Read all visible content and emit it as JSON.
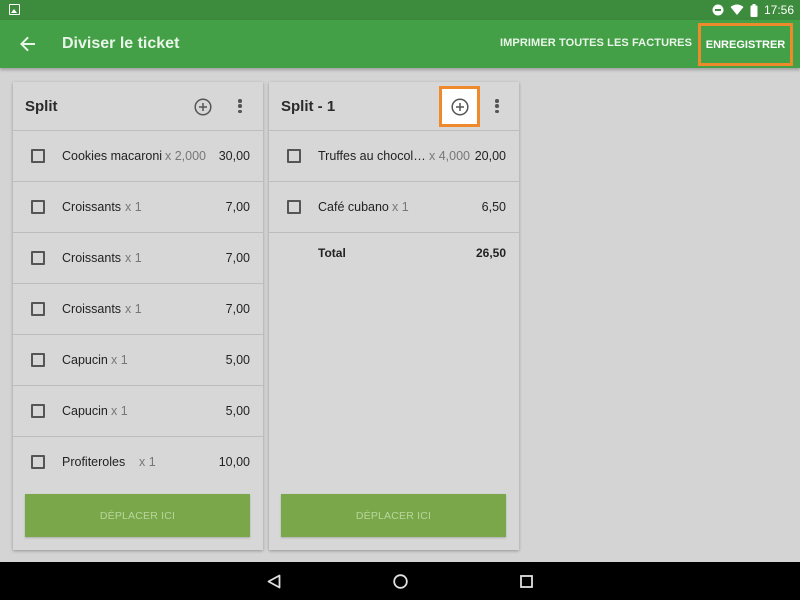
{
  "status_bar": {
    "time": "17:56",
    "icons": [
      "image-icon",
      "do-not-disturb-icon",
      "wifi-icon",
      "battery-icon"
    ]
  },
  "app_bar": {
    "title": "Diviser le ticket",
    "print_all_label": "IMPRIMER TOUTES LES FACTURES",
    "save_label": "ENREGISTRER",
    "background": "#43a047",
    "highlight_color": "#ee8a2c"
  },
  "panels": [
    {
      "title": "Split",
      "items": [
        {
          "name": "Cookies macaroni",
          "qty": "x 2,000",
          "price": "30,00"
        },
        {
          "name": "Croissants",
          "qty": "x 1",
          "price": "7,00"
        },
        {
          "name": "Croissants",
          "qty": "x 1",
          "price": "7,00"
        },
        {
          "name": "Croissants",
          "qty": "x 1",
          "price": "7,00"
        },
        {
          "name": "Capucin",
          "qty": "x 1",
          "price": "5,00"
        },
        {
          "name": "Capucin",
          "qty": "x 1",
          "price": "5,00"
        },
        {
          "name": "Profiteroles",
          "qty": "x 1",
          "price": "10,00"
        }
      ],
      "move_label": "DÉPLACER ICI"
    },
    {
      "title": "Split - 1",
      "items": [
        {
          "name": "Truffes au chocol…",
          "qty": "x 4,000",
          "price": "20,00"
        },
        {
          "name": "Café cubano",
          "qty": "x 1",
          "price": "6,50"
        }
      ],
      "total_label": "Total",
      "total_value": "26,50",
      "move_label": "DÉPLACER ICI"
    }
  ]
}
